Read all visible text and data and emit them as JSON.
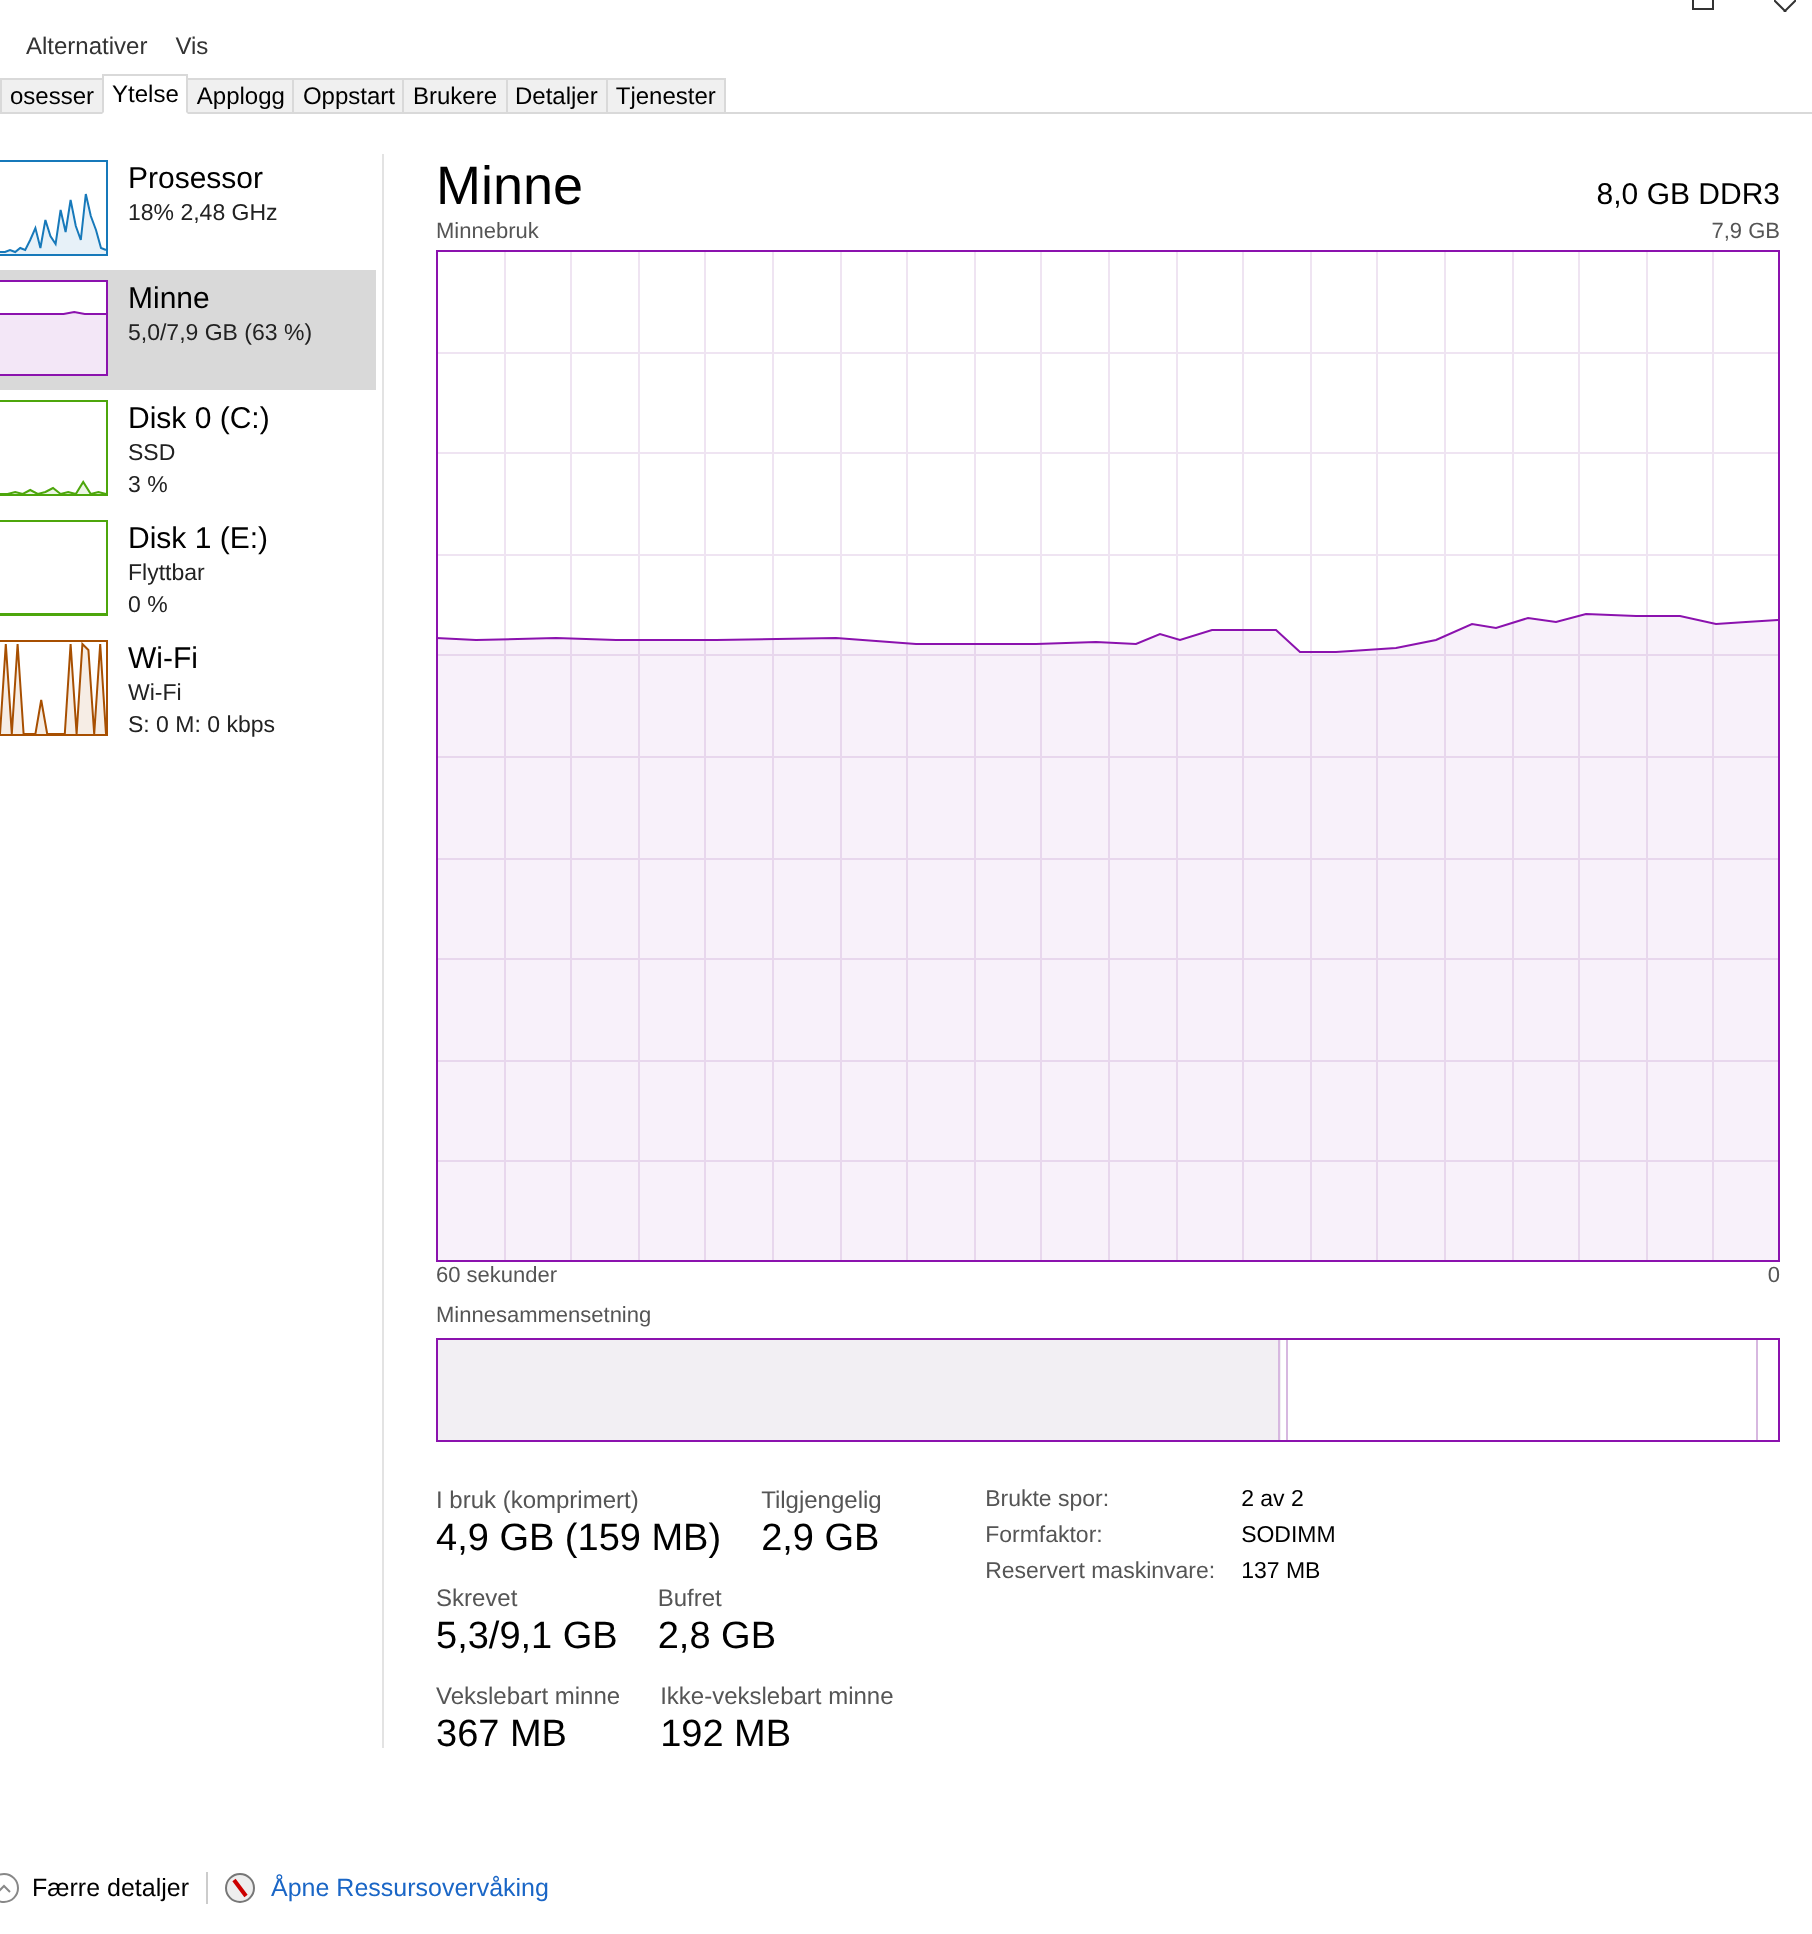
{
  "menu": [
    "Alternativer",
    "Vis"
  ],
  "tabs": [
    {
      "label": "osesser",
      "selected": false
    },
    {
      "label": "Ytelse",
      "selected": true
    },
    {
      "label": "Applogg",
      "selected": false
    },
    {
      "label": "Oppstart",
      "selected": false
    },
    {
      "label": "Brukere",
      "selected": false
    },
    {
      "label": "Detaljer",
      "selected": false
    },
    {
      "label": "Tjenester",
      "selected": false
    }
  ],
  "sidebar": {
    "items": [
      {
        "kind": "spiky",
        "name": "Prosessor",
        "lines": [
          "18% 2,48 GHz"
        ],
        "color": "#1779ba",
        "selected": false
      },
      {
        "kind": "flat",
        "name": "Minne",
        "lines": [
          "5,0/7,9 GB (63 %)"
        ],
        "color": "#8b12ae",
        "selected": true
      },
      {
        "kind": "low",
        "name": "Disk 0 (C:)",
        "lines": [
          "SSD",
          "3 %"
        ],
        "color": "#4da60c",
        "selected": false
      },
      {
        "kind": "empty",
        "name": "Disk 1 (E:)",
        "lines": [
          "Flyttbar",
          "0 %"
        ],
        "color": "#4da60c",
        "selected": false
      },
      {
        "kind": "bursts",
        "name": "Wi-Fi",
        "lines": [
          "Wi-Fi",
          "S: 0 M: 0 kbps"
        ],
        "color": "#a74f01",
        "selected": false
      }
    ]
  },
  "main": {
    "title": "Minne",
    "spec": "8,0 GB DDR3",
    "graph": {
      "label": "Minnebruk",
      "max": "7,9 GB",
      "x_start": "60 sekunder",
      "x_end": "0"
    },
    "composition": {
      "label": "Minnesammensetning"
    },
    "stat_rows": [
      {
        "items": [
          {
            "label": "I bruk (komprimert)",
            "value": "4,9 GB (159 MB)"
          },
          {
            "label": "Tilgjengelig",
            "value": "2,9 GB"
          }
        ]
      },
      {
        "items": [
          {
            "label": "Skrevet",
            "value": "5,3/9,1 GB"
          },
          {
            "label": "Bufret",
            "value": "2,8 GB"
          }
        ]
      },
      {
        "items": [
          {
            "label": "Vekslebart minne",
            "value": "367 MB"
          },
          {
            "label": "Ikke-vekslebart minne",
            "value": "192 MB"
          }
        ]
      }
    ],
    "details": [
      {
        "label": "Brukte spor:",
        "value": "2 av 2"
      },
      {
        "label": "Formfaktor:",
        "value": "SODIMM"
      },
      {
        "label": "Reservert maskinvare:",
        "value": "137 MB"
      }
    ]
  },
  "footer": {
    "fewer_details": "Færre detaljer",
    "link": "Åpne Ressursovervåking"
  }
}
